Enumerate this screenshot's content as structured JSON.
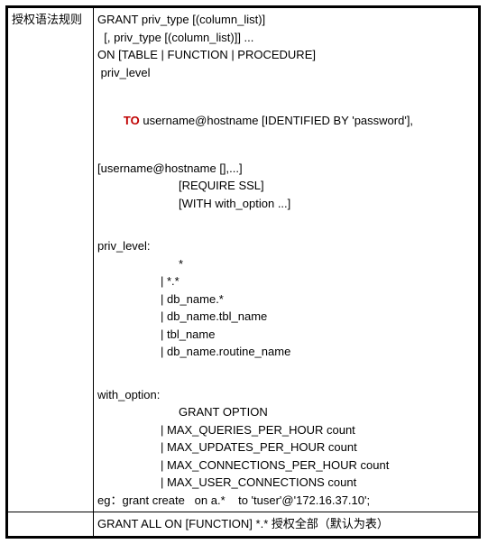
{
  "row1": {
    "label": "授权语法规则",
    "lines": {
      "l1": "GRANT priv_type [(column_list)]",
      "l2": "  [, priv_type [(column_list)]] ...",
      "l3": "ON [TABLE | FUNCTION | PROCEDURE]",
      "l4": " priv_level",
      "l5a": "TO",
      "l5b": " username@hostname [IDENTIFIED BY 'password'],",
      "l6": "[username@hostname [],...]",
      "l7": "[REQUIRE SSL]",
      "l8": "[WITH with_option ...]",
      "pl_head": "priv_level:",
      "pl1": "*",
      "pl2": "| *.*",
      "pl3": "| db_name.*",
      "pl4": "| db_name.tbl_name",
      "pl5": "| tbl_name",
      "pl6": "| db_name.routine_name",
      "wo_head": "with_option:",
      "wo1": "GRANT OPTION",
      "wo2": "| MAX_QUERIES_PER_HOUR count",
      "wo3": "| MAX_UPDATES_PER_HOUR count",
      "wo4": "| MAX_CONNECTIONS_PER_HOUR count",
      "wo5": "| MAX_USER_CONNECTIONS count",
      "eg": "eg：grant create   on a.*    to 'tuser'@'172.16.37.10';"
    }
  },
  "row2": {
    "label": "",
    "text": "GRANT ALL ON [FUNCTION] *.*   授权全部（默认为表）"
  }
}
